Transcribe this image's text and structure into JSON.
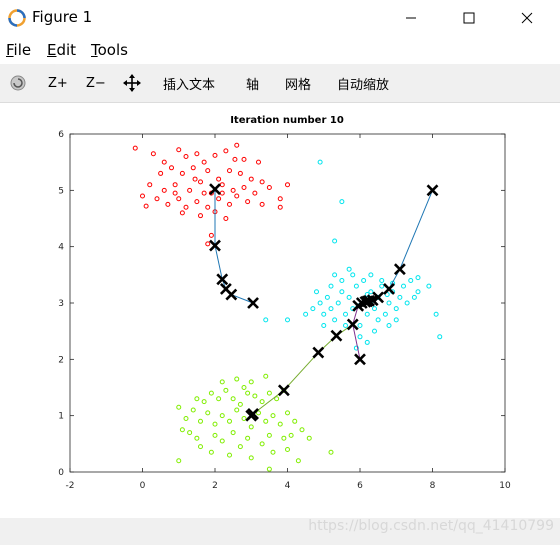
{
  "window": {
    "title": "Figure 1",
    "controls": {
      "minimize": "minimize-icon",
      "maximize": "maximize-icon",
      "close": "close-icon"
    }
  },
  "menu": {
    "file": "ile",
    "file_key": "F",
    "edit": "dit",
    "edit_key": "E",
    "tools": "ools",
    "tools_key": "T"
  },
  "toolbar": {
    "zoom_in": "Z+",
    "zoom_out": "Z−",
    "insert_text": "插入文本",
    "axis": "轴",
    "grid": "网格",
    "autoscale": "自动缩放"
  },
  "watermark": "https://blog.csdn.net/qq_41410799",
  "colors": {
    "cluster1": "#ff0000",
    "cluster2": "#00e5ee",
    "cluster3": "#80ee00",
    "centroid": "#000000"
  },
  "chart_data": {
    "type": "scatter",
    "title": "Iteration number 10",
    "xlim": [
      -2,
      10
    ],
    "ylim": [
      0,
      6
    ],
    "xticks": [
      "-2",
      "0",
      "2",
      "4",
      "6",
      "8",
      "10"
    ],
    "yticks": [
      "0",
      "1",
      "2",
      "3",
      "4",
      "5",
      "6"
    ],
    "grid": false,
    "clusters": [
      {
        "color": "#ff0000",
        "points": [
          [
            -0.2,
            5.75
          ],
          [
            0.3,
            5.65
          ],
          [
            0.6,
            5.5
          ],
          [
            1.0,
            5.72
          ],
          [
            1.2,
            5.6
          ],
          [
            1.5,
            5.65
          ],
          [
            1.7,
            5.5
          ],
          [
            2.0,
            5.62
          ],
          [
            2.3,
            5.7
          ],
          [
            2.6,
            5.8
          ],
          [
            2.8,
            5.55
          ],
          [
            3.2,
            5.5
          ],
          [
            0.5,
            5.3
          ],
          [
            0.8,
            5.4
          ],
          [
            1.1,
            5.3
          ],
          [
            1.4,
            5.4
          ],
          [
            1.8,
            5.35
          ],
          [
            2.1,
            5.2
          ],
          [
            2.4,
            5.35
          ],
          [
            2.7,
            5.3
          ],
          [
            3.0,
            5.2
          ],
          [
            0.2,
            5.1
          ],
          [
            0.6,
            5.0
          ],
          [
            0.9,
            5.1
          ],
          [
            1.3,
            5.0
          ],
          [
            1.6,
            5.15
          ],
          [
            1.9,
            4.95
          ],
          [
            2.2,
            5.1
          ],
          [
            2.5,
            5.0
          ],
          [
            2.8,
            5.05
          ],
          [
            3.1,
            4.95
          ],
          [
            3.5,
            5.05
          ],
          [
            4.0,
            5.1
          ],
          [
            0.4,
            4.85
          ],
          [
            0.7,
            4.75
          ],
          [
            1.0,
            4.85
          ],
          [
            1.2,
            4.7
          ],
          [
            1.5,
            4.8
          ],
          [
            1.8,
            4.7
          ],
          [
            2.1,
            4.85
          ],
          [
            2.4,
            4.75
          ],
          [
            2.6,
            4.9
          ],
          [
            2.9,
            4.8
          ],
          [
            3.3,
            4.75
          ],
          [
            3.8,
            4.85
          ],
          [
            0.1,
            4.72
          ],
          [
            1.1,
            4.6
          ],
          [
            1.6,
            4.55
          ],
          [
            2.0,
            4.62
          ],
          [
            2.3,
            4.5
          ],
          [
            1.9,
            4.2
          ],
          [
            1.8,
            4.05
          ],
          [
            3.8,
            4.7
          ],
          [
            0.9,
            4.95
          ],
          [
            1.45,
            5.2
          ],
          [
            2.55,
            5.55
          ],
          [
            0.0,
            4.9
          ],
          [
            3.3,
            5.15
          ],
          [
            1.7,
            4.95
          ],
          [
            2.2,
            4.95
          ]
        ]
      },
      {
        "color": "#00e5ee",
        "points": [
          [
            4.9,
            5.5
          ],
          [
            5.5,
            4.8
          ],
          [
            5.3,
            4.1
          ],
          [
            3.4,
            2.7
          ],
          [
            4.0,
            2.7
          ],
          [
            8.2,
            2.4
          ],
          [
            8.1,
            2.8
          ],
          [
            7.6,
            3.2
          ],
          [
            7.9,
            3.3
          ],
          [
            4.5,
            2.8
          ],
          [
            4.7,
            2.9
          ],
          [
            4.9,
            3.0
          ],
          [
            5.0,
            2.8
          ],
          [
            5.1,
            3.1
          ],
          [
            5.2,
            2.9
          ],
          [
            5.3,
            2.7
          ],
          [
            5.4,
            3.0
          ],
          [
            5.5,
            3.2
          ],
          [
            5.6,
            2.8
          ],
          [
            5.7,
            3.1
          ],
          [
            5.8,
            2.9
          ],
          [
            5.9,
            3.3
          ],
          [
            6.0,
            2.6
          ],
          [
            6.1,
            3.0
          ],
          [
            6.2,
            2.8
          ],
          [
            6.3,
            3.2
          ],
          [
            6.4,
            2.9
          ],
          [
            6.5,
            3.1
          ],
          [
            6.6,
            3.3
          ],
          [
            6.7,
            2.8
          ],
          [
            6.8,
            3.0
          ],
          [
            6.9,
            3.2
          ],
          [
            7.0,
            2.9
          ],
          [
            7.1,
            3.1
          ],
          [
            7.2,
            3.3
          ],
          [
            7.3,
            3.0
          ],
          [
            7.4,
            3.4
          ],
          [
            7.5,
            3.1
          ],
          [
            7.6,
            3.45
          ],
          [
            5.5,
            3.4
          ],
          [
            5.8,
            3.5
          ],
          [
            6.1,
            3.4
          ],
          [
            6.3,
            3.5
          ],
          [
            6.6,
            3.4
          ],
          [
            6.9,
            3.35
          ],
          [
            5.2,
            3.3
          ],
          [
            5.6,
            2.6
          ],
          [
            6.0,
            2.4
          ],
          [
            6.4,
            2.5
          ],
          [
            6.8,
            2.6
          ],
          [
            5.9,
            2.2
          ],
          [
            6.2,
            2.3
          ],
          [
            5.0,
            2.6
          ],
          [
            4.8,
            3.2
          ],
          [
            5.3,
            3.5
          ],
          [
            5.7,
            3.6
          ],
          [
            6.5,
            2.7
          ],
          [
            7.0,
            2.7
          ],
          [
            6.2,
            3.15
          ],
          [
            5.95,
            2.95
          ],
          [
            6.35,
            3.05
          ],
          [
            6.75,
            3.15
          ]
        ]
      },
      {
        "color": "#80ee00",
        "points": [
          [
            1.0,
            0.2
          ],
          [
            1.1,
            0.75
          ],
          [
            1.5,
            0.6
          ],
          [
            1.9,
            0.35
          ],
          [
            2.2,
            0.55
          ],
          [
            2.4,
            0.3
          ],
          [
            2.7,
            0.45
          ],
          [
            3.0,
            0.25
          ],
          [
            3.3,
            0.5
          ],
          [
            3.6,
            0.35
          ],
          [
            4.0,
            0.4
          ],
          [
            4.3,
            0.2
          ],
          [
            1.2,
            0.95
          ],
          [
            1.4,
            1.1
          ],
          [
            1.6,
            0.9
          ],
          [
            1.8,
            1.05
          ],
          [
            2.0,
            0.85
          ],
          [
            2.2,
            1.0
          ],
          [
            2.4,
            0.9
          ],
          [
            2.6,
            1.1
          ],
          [
            2.8,
            0.95
          ],
          [
            3.0,
            0.8
          ],
          [
            3.2,
            1.05
          ],
          [
            3.4,
            0.9
          ],
          [
            3.6,
            1.0
          ],
          [
            3.8,
            0.85
          ],
          [
            4.0,
            1.05
          ],
          [
            4.2,
            0.9
          ],
          [
            1.5,
            1.3
          ],
          [
            1.7,
            1.25
          ],
          [
            1.9,
            1.4
          ],
          [
            2.1,
            1.3
          ],
          [
            2.3,
            1.45
          ],
          [
            2.5,
            1.3
          ],
          [
            2.7,
            1.2
          ],
          [
            2.9,
            1.4
          ],
          [
            3.1,
            1.35
          ],
          [
            3.3,
            1.25
          ],
          [
            3.5,
            1.4
          ],
          [
            3.7,
            1.3
          ],
          [
            3.9,
            1.45
          ],
          [
            2.2,
            1.6
          ],
          [
            2.6,
            1.65
          ],
          [
            3.0,
            1.6
          ],
          [
            3.4,
            1.7
          ],
          [
            2.8,
            1.5
          ],
          [
            1.0,
            1.15
          ],
          [
            4.4,
            0.75
          ],
          [
            4.6,
            0.6
          ],
          [
            5.2,
            0.35
          ],
          [
            3.5,
            0.05
          ],
          [
            1.3,
            0.7
          ],
          [
            2.0,
            0.65
          ],
          [
            2.5,
            0.7
          ],
          [
            3.5,
            0.65
          ],
          [
            3.9,
            0.6
          ],
          [
            4.1,
            0.65
          ],
          [
            2.9,
            0.6
          ],
          [
            1.6,
            0.45
          ]
        ]
      }
    ],
    "trajectories": [
      {
        "color": "#1f77b4",
        "points": [
          [
            3.05,
            3.0
          ],
          [
            2.45,
            3.15
          ],
          [
            2.3,
            3.25
          ],
          [
            2.2,
            3.42
          ],
          [
            2.0,
            4.02
          ],
          [
            2.0,
            5.02
          ]
        ]
      },
      {
        "color": "#7e2f8e",
        "points": [
          [
            6.0,
            2.0
          ],
          [
            5.8,
            2.62
          ],
          [
            5.95,
            2.95
          ],
          [
            6.05,
            3.0
          ],
          [
            6.15,
            3.02
          ],
          [
            6.2,
            3.03
          ]
        ]
      },
      {
        "color": "#1f77b4",
        "points": [
          [
            8.0,
            5.0
          ],
          [
            7.1,
            3.6
          ],
          [
            6.8,
            3.25
          ],
          [
            6.5,
            3.1
          ],
          [
            6.35,
            3.05
          ],
          [
            6.25,
            3.04
          ]
        ]
      },
      {
        "color": "#77ac30",
        "points": [
          [
            3.05,
            1.03
          ],
          [
            3.9,
            1.45
          ],
          [
            4.85,
            2.12
          ],
          [
            5.35,
            2.42
          ],
          [
            5.8,
            2.62
          ]
        ]
      }
    ],
    "centroids": [
      [
        3.05,
        3.0
      ],
      [
        2.45,
        3.15
      ],
      [
        2.3,
        3.25
      ],
      [
        2.2,
        3.42
      ],
      [
        2.0,
        4.02
      ],
      [
        2.0,
        5.02
      ],
      [
        6.0,
        2.0
      ],
      [
        5.8,
        2.62
      ],
      [
        5.95,
        2.95
      ],
      [
        6.05,
        3.0
      ],
      [
        6.15,
        3.02
      ],
      [
        6.2,
        3.03
      ],
      [
        8.0,
        5.0
      ],
      [
        7.1,
        3.6
      ],
      [
        6.8,
        3.25
      ],
      [
        6.5,
        3.1
      ],
      [
        6.35,
        3.05
      ],
      [
        6.25,
        3.04
      ],
      [
        3.05,
        1.03
      ],
      [
        3.0,
        1.0
      ],
      [
        3.9,
        1.45
      ],
      [
        4.85,
        2.12
      ],
      [
        5.35,
        2.42
      ]
    ]
  }
}
